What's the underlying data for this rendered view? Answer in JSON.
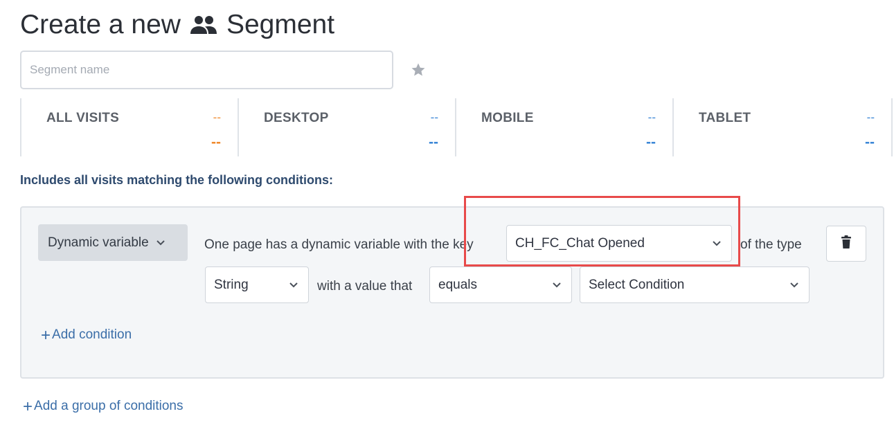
{
  "header": {
    "title_prefix": "Create a new",
    "title_suffix": "Segment",
    "title_icon": "people-icon"
  },
  "segment_name": {
    "placeholder": "Segment name",
    "value": ""
  },
  "favorite_icon": "star-icon",
  "stats": [
    {
      "label": "ALL VISITS",
      "small_value": "--",
      "big_value": "--",
      "color": "#f0892b"
    },
    {
      "label": "DESKTOP",
      "small_value": "--",
      "big_value": "--",
      "color": "#3a86d6"
    },
    {
      "label": "MOBILE",
      "small_value": "--",
      "big_value": "--",
      "color": "#3a86d6"
    },
    {
      "label": "TABLET",
      "small_value": "--",
      "big_value": "--",
      "color": "#3a86d6"
    }
  ],
  "conditions_label": "Includes all visits matching the following conditions:",
  "condition": {
    "type_label": "Dynamic variable",
    "text_key": "One page has a dynamic variable with the key",
    "key_value": "CH_FC_Chat Opened",
    "text_of_type": "of the type",
    "value_type": "String",
    "text_value_that": "with a value that",
    "operator": "equals",
    "value_placeholder": "Select Condition"
  },
  "add_condition": {
    "plus": "+",
    "label": "Add condition"
  },
  "add_group": {
    "plus": "+",
    "label": "Add a group of conditions"
  },
  "colors": {
    "accent_link": "#3b6ea8",
    "highlight_border": "#e84a4a"
  }
}
